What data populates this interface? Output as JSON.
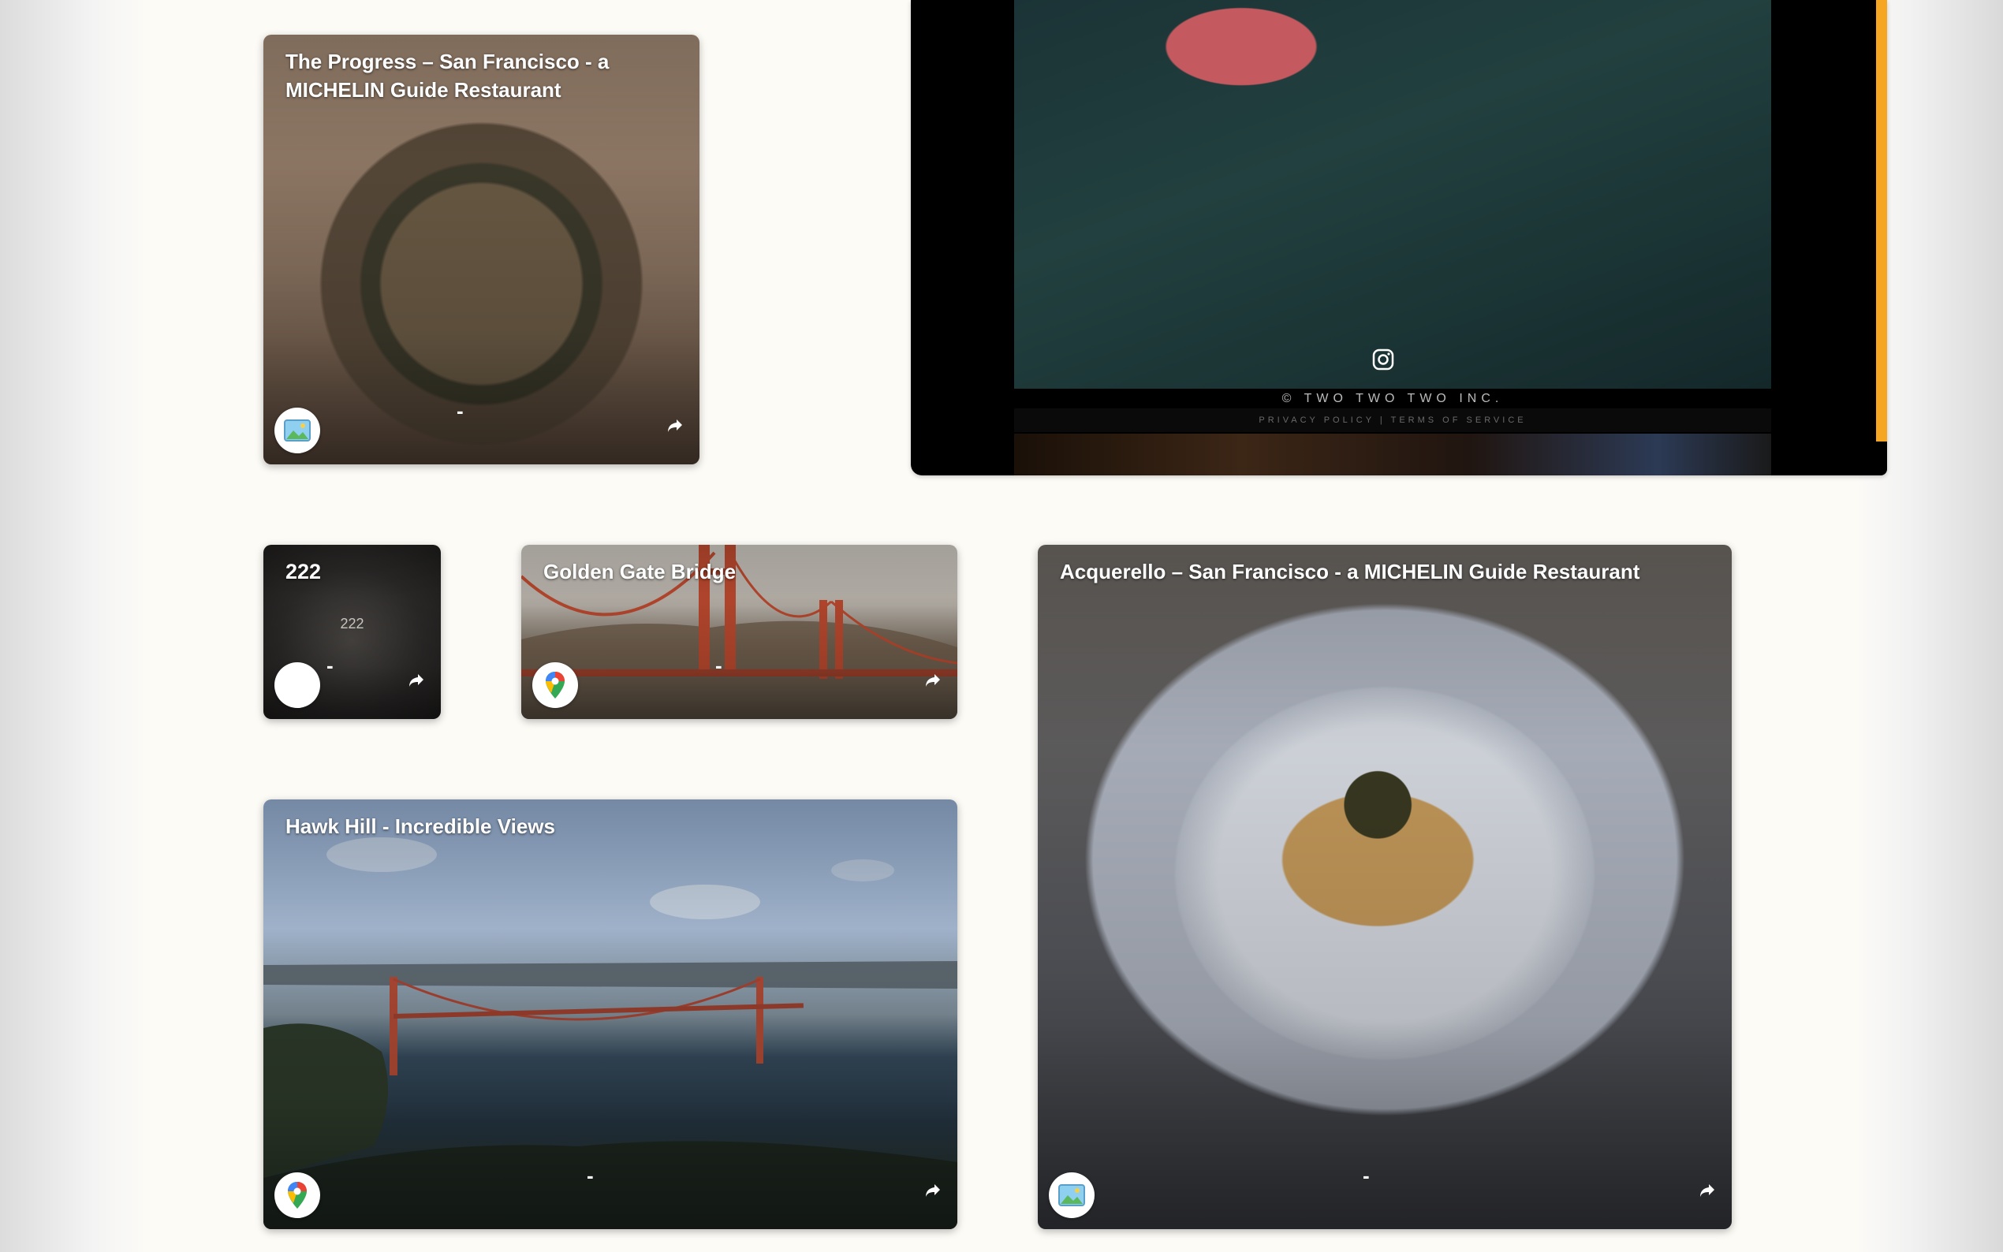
{
  "cards": {
    "progress": {
      "title": "The Progress – San Francisco - a MICHELIN Guide Restaurant",
      "meta": "-",
      "badge_icon": "photo-icon"
    },
    "two22": {
      "title": "222",
      "meta": "-",
      "badge_icon": "blank-icon",
      "photo_caption": "222"
    },
    "ggb": {
      "title": "Golden Gate Bridge",
      "meta": "-",
      "badge_icon": "google-maps-icon"
    },
    "hawk": {
      "title": "Hawk Hill - Incredible Views",
      "meta": "-",
      "badge_icon": "google-maps-icon"
    },
    "acquerello": {
      "title": "Acquerello – San Francisco - a MICHELIN Guide Restaurant",
      "meta": "-",
      "badge_icon": "photo-icon"
    }
  },
  "video": {
    "copyright": "© TWO TWO TWO INC.",
    "legal": "PRIVACY POLICY | TERMS OF SERVICE",
    "scrollbar_color": "#f5a623"
  },
  "colors": {
    "page_bg": "#fdfbf6",
    "card_text": "#ffffff"
  }
}
